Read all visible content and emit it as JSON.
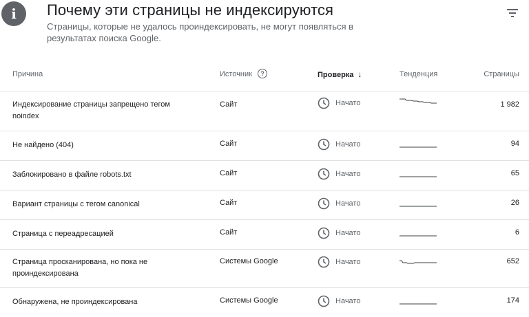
{
  "header": {
    "title": "Почему эти страницы не индексируются",
    "subtitle": "Страницы, которые не удалось проиндексировать, не могут появляться в результатах поиска Google."
  },
  "table": {
    "columns": {
      "reason": "Причина",
      "source": "Источник",
      "check": "Проверка",
      "trend": "Тенденция",
      "pages": "Страницы"
    },
    "rows": [
      {
        "reason": "Индексирование страницы запрещено тегом noindex",
        "source": "Сайт",
        "status": "Начато",
        "pages": "1 982"
      },
      {
        "reason": "Не найдено (404)",
        "source": "Сайт",
        "status": "Начато",
        "pages": "94"
      },
      {
        "reason": "Заблокировано в файле robots.txt",
        "source": "Сайт",
        "status": "Начато",
        "pages": "65"
      },
      {
        "reason": "Вариант страницы с тегом canonical",
        "source": "Сайт",
        "status": "Начато",
        "pages": "26"
      },
      {
        "reason": "Страница с переадресацией",
        "source": "Сайт",
        "status": "Начато",
        "pages": "6"
      },
      {
        "reason": "Страница просканирована, но пока не проиндексирована",
        "source": "Системы Google",
        "status": "Начато",
        "pages": "652"
      },
      {
        "reason": "Обнаружена, не проиндексирована",
        "source": "Системы Google",
        "status": "Начато",
        "pages": "174"
      }
    ]
  },
  "icons": {
    "info": "info-icon",
    "filter": "filter-icon",
    "help": "help-icon",
    "sort": "arrow-down-icon",
    "status": "clock-icon"
  },
  "colors": {
    "icon_gray": "#5f6368",
    "divider": "#e0e0e0"
  }
}
